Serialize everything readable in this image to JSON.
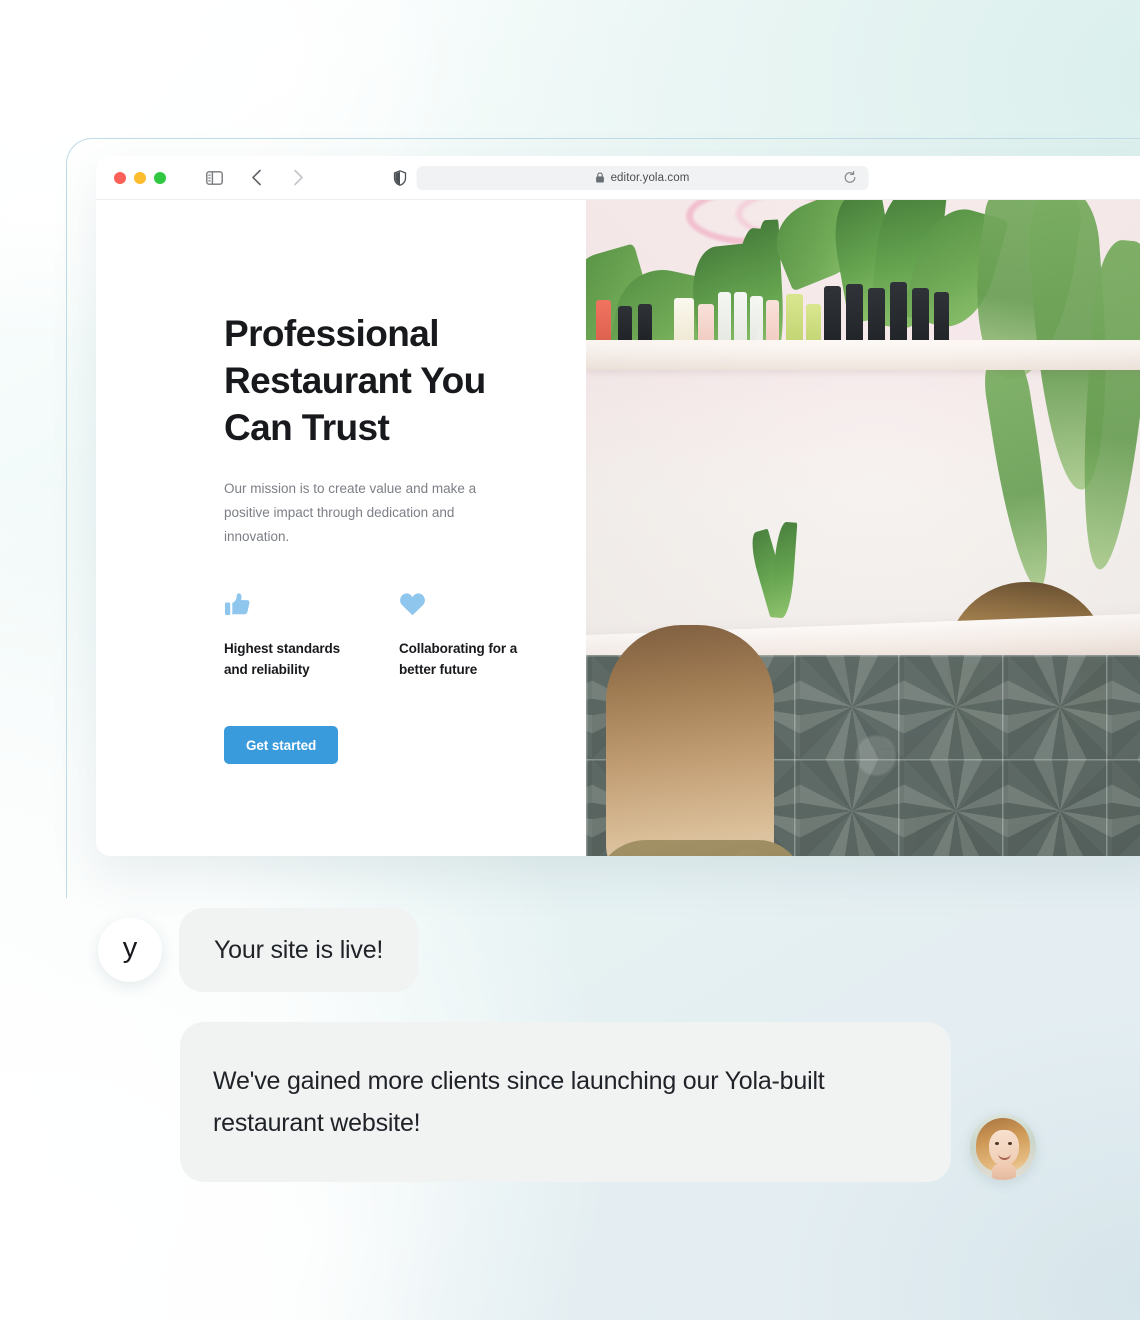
{
  "browser": {
    "traffic_lights": [
      "close",
      "minimize",
      "maximize"
    ],
    "sidebar_icon": "sidebar-toggle-icon",
    "back_icon": "chevron-left-icon",
    "forward_icon": "chevron-right-icon",
    "shield_icon": "shield-privacy-icon",
    "lock_icon": "lock-icon",
    "url": "editor.yola.com",
    "reload_icon": "reload-icon"
  },
  "hero": {
    "heading": "Professional Restaurant You Can Trust",
    "subheading": "Our mission is to create value and make a positive impact through dedication and innovation.",
    "features": [
      {
        "icon": "thumbs-up-icon",
        "label": "Highest standards and reliability"
      },
      {
        "icon": "heart-icon",
        "label": "Collaborating for a better future"
      }
    ],
    "cta_label": "Get started",
    "photo_alt": "Two women at a shop counter surrounded by plants"
  },
  "chat": {
    "brand_initial": "y",
    "messages": [
      {
        "from": "yola",
        "text": "Your site is live!"
      },
      {
        "from": "client",
        "text": "We've gained more clients since launching our Yola-built restaurant website!"
      }
    ]
  },
  "colors": {
    "accent_blue": "#3a9bdc",
    "icon_blue": "#8fc6ee",
    "heading_dark": "#17191c",
    "body_gray": "#7b7f85",
    "bubble_gray": "#f1f2f2",
    "frame_border": "#bfdbe6"
  }
}
